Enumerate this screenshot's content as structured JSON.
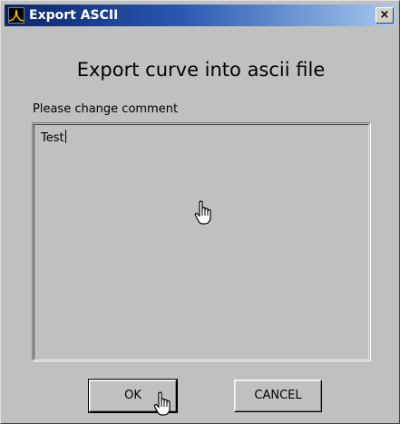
{
  "window": {
    "title": "Export ASCII",
    "close_glyph": "×",
    "app_icon": "waveform-app-icon",
    "close_icon": "close-icon"
  },
  "dialog": {
    "heading": "Export curve into ascii file",
    "comment_label": "Please change comment",
    "comment_value": "Test"
  },
  "buttons": {
    "ok_label": "OK",
    "cancel_label": "CANCEL"
  },
  "colors": {
    "title_bar_start": "#0a246a",
    "title_bar_end": "#a6caf0",
    "dialog_background": "#c0c0c0",
    "app_icon_accent": "#f0c000"
  },
  "cursors": [
    "hand-pointer-icon",
    "hand-pointer-icon"
  ]
}
